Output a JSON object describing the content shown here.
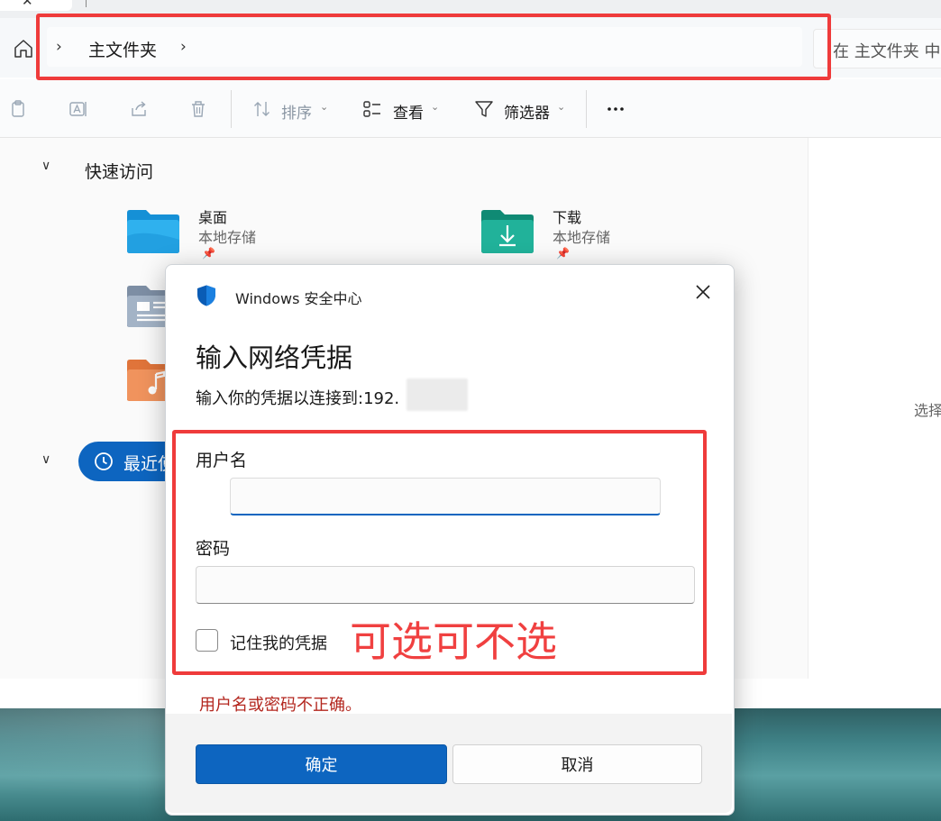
{
  "explorer": {
    "address": {
      "path_label": "主文件夹"
    },
    "search": {
      "placeholder_text": "在 主文件夹 中"
    },
    "toolbar": {
      "sort_label": "排序",
      "view_label": "查看",
      "filter_label": "筛选器"
    },
    "quick_access": {
      "label": "快速访问",
      "folders": [
        {
          "name": "桌面",
          "sub": "本地存储"
        },
        {
          "name": "下载",
          "sub": "本地存储"
        }
      ]
    },
    "recent_label": "最近使",
    "details_hint": "选择"
  },
  "dialog": {
    "app_title": "Windows 安全中心",
    "heading": "输入网络凭据",
    "subtitle": "输入你的凭据以连接到:192.",
    "username_label": "用户名",
    "password_label": "密码",
    "remember_label": "记住我的凭据",
    "error_text": "用户名或密码不正确。",
    "ok_label": "确定",
    "cancel_label": "取消"
  },
  "annotation": {
    "text": "可选可不选"
  },
  "colors": {
    "accent": "#0d65c0",
    "annotation_red": "#ef3b3b",
    "error_red": "#b3261e"
  }
}
